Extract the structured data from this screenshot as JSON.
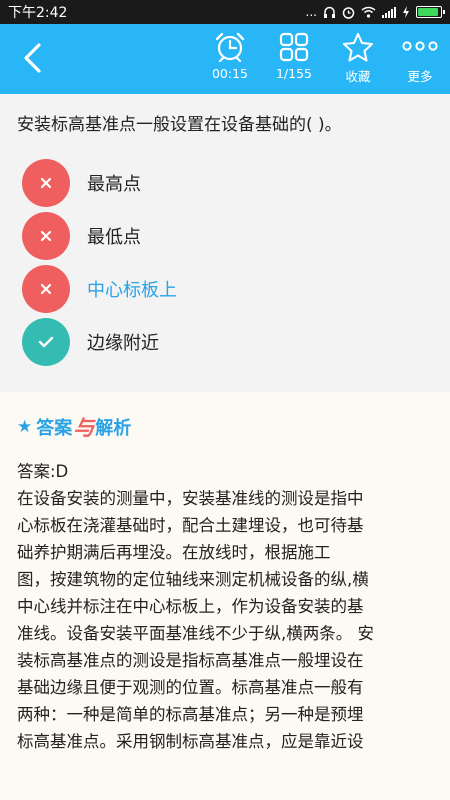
{
  "status_bar": {
    "time": "下午2:42",
    "dots": "...",
    "battery_percent": 0.85
  },
  "toolbar": {
    "timer": "00:15",
    "progress": "1/155",
    "favorite": "收藏",
    "more": "更多"
  },
  "question": {
    "text": "安装标高基准点一般设置在设备基础的(     )。",
    "options": [
      {
        "label": "最高点",
        "state": "wrong"
      },
      {
        "label": "最低点",
        "state": "wrong"
      },
      {
        "label": "中心标板上",
        "state": "selected-wrong"
      },
      {
        "label": "边缘附近",
        "state": "correct"
      }
    ]
  },
  "analysis": {
    "title_part1": "答案",
    "title_part2": "与",
    "title_part3": "解析",
    "lines": [
      "答案:D",
      "在设备安装的测量中，安装基准线的测设是指中",
      "心标板在浇灌基础时，配合土建埋设，也可待基",
      "础养护期满后再埋没。在放线时，根据施工",
      "图，按建筑物的定位轴线来测定机械设备的纵,横",
      "中心线并标注在中心标板上，作为设备安装的基",
      "准线。设备安装平面基准线不少于纵,横两条。  安",
      "装标高基准点的测设是指标高基准点一般埋设在",
      "基础边缘且便于观测的位置。标高基准点一般有",
      "两种：一种是简单的标高基准点；另一种是预埋",
      "标高基准点。采用钢制标高基准点，应是靠近设"
    ]
  },
  "colors": {
    "accent": "#29b6f6",
    "wrong": "#ef5f5f",
    "correct": "#35bcb2",
    "selected_text": "#2aa3e6"
  }
}
